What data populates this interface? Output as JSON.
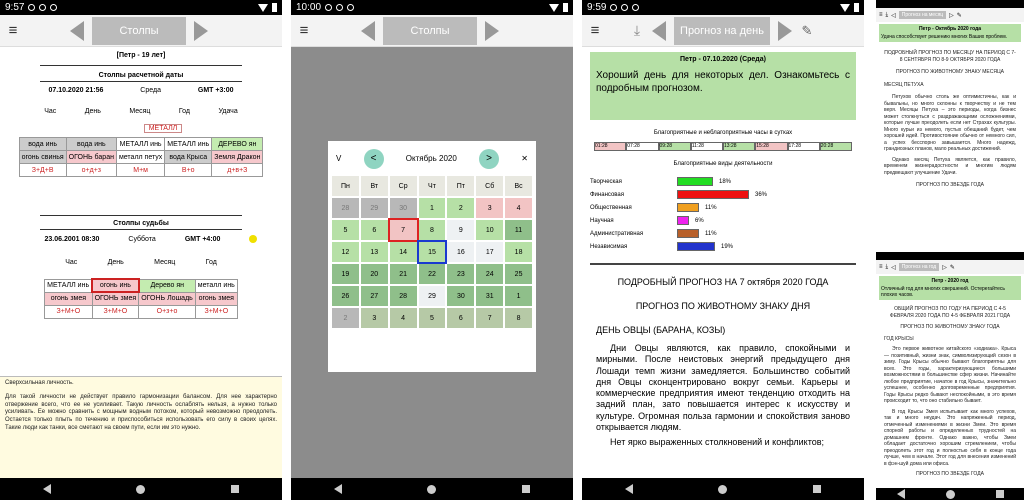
{
  "phone1": {
    "time": "9:57",
    "title": "Столпы",
    "name": "[Петр - 19 лет]",
    "sec1": "Столпы расчетной даты",
    "date1": "07.10.2020 21:56",
    "day1": "Среда",
    "gmt1": "GMT +3:00",
    "cols": [
      "Час",
      "День",
      "Месяц",
      "Год",
      "Удача"
    ],
    "extra": "МЕТАЛЛ",
    "r1": [
      "вода инь",
      "вода инь",
      "МЕТАЛЛ инь",
      "МЕТАЛЛ инь",
      "ДЕРЕВО ян"
    ],
    "r2": [
      "огонь свинья",
      "ОГОНЬ баран",
      "металл петух",
      "вода Крыса",
      "Земля Дракон"
    ],
    "r3": [
      "З+Д+В",
      "о+д+з",
      "М+м",
      "В+о",
      "д+в+З"
    ],
    "sec2": "Столпы судьбы",
    "date2": "23.06.2001 08:30",
    "day2": "Суббота",
    "gmt2": "GMT +4:00",
    "cols2": [
      "Час",
      "День",
      "Месяц",
      "Год"
    ],
    "s1": [
      "МЕТАЛЛ инь",
      "огонь инь",
      "Дерево ян",
      "металл инь"
    ],
    "s2": [
      "огонь змея",
      "ОГОНЬ змея",
      "ОГОНЬ Лошадь",
      "огонь змея"
    ],
    "s3": [
      "З+М+О",
      "З+М+О",
      "О+з+о",
      "З+М+О"
    ],
    "desc": [
      "Сверхсильная личность.",
      "Для такой личности не действует правило гармонизации балансом. Для нее характерно отвержение всего, что ее не усиливает. Такую личность ослаблять нельзя, а нужно только усиливать. Ее можно сравнить с мощным водным потоком, который невозможно преодолеть. Остается только плыть по течению и приспособиться использовать его силу в своих целях. Такие люди как танки, все сметают на своем пути, если им это нужно."
    ]
  },
  "phone2": {
    "time": "10:00",
    "title": "Столпы",
    "month": "Октябрь 2020",
    "wd": [
      "Пн",
      "Вт",
      "Ср",
      "Чт",
      "Пт",
      "Сб",
      "Вс"
    ],
    "days": [
      "28",
      "29",
      "30",
      "1",
      "2",
      "3",
      "4",
      "5",
      "6",
      "7",
      "8",
      "9",
      "10",
      "11",
      "12",
      "13",
      "14",
      "15",
      "16",
      "17",
      "18",
      "19",
      "20",
      "21",
      "22",
      "23",
      "24",
      "25",
      "26",
      "27",
      "28",
      "29",
      "30",
      "31",
      "1",
      "2",
      "3",
      "4",
      "5",
      "6",
      "7",
      "8"
    ],
    "v": "V",
    "close": "✕",
    "prev": "<",
    "next": ">"
  },
  "phone3": {
    "time": "9:59",
    "title": "Прогноз на день",
    "head": "Петр - 07.10.2020 (Среда)",
    "lead": "Хороший день для некоторых дел. Ознакомьтесь с подробным прогнозом.",
    "hours_title": "Благоприятные и неблагоприятные часы в сутках",
    "hours": [
      "01:28",
      "07:28",
      "09:28",
      "11:28",
      "13:28",
      "15:28",
      "17:28",
      "20:28"
    ],
    "act_title": "Благоприятные виды деятельности",
    "acts": [
      {
        "n": "Творческая",
        "p": "18%",
        "v": 18,
        "c": "#22dd22"
      },
      {
        "n": "Финансовая",
        "p": "36%",
        "v": 36,
        "c": "#ee1111"
      },
      {
        "n": "Общественная",
        "p": "11%",
        "v": 11,
        "c": "#f0a020"
      },
      {
        "n": "Научная",
        "p": "6%",
        "v": 6,
        "c": "#ee22ee"
      },
      {
        "n": "Административная",
        "p": "11%",
        "v": 11,
        "c": "#b8602a"
      },
      {
        "n": "Независимая",
        "p": "19%",
        "v": 19,
        "c": "#2233cc"
      }
    ],
    "h1": "ПОДРОБНЫЙ ПРОГНОЗ НА 7 октября 2020 ГОДА",
    "h2": "ПРОГНОЗ ПО ЖИВОТНОМУ ЗНАКУ ДНЯ",
    "h3": "ДЕНЬ ОВЦЫ (БАРАНА, КОЗЫ)",
    "p1": "Дни Овцы являются, как правило, спокойными и мирными. После неистовых энергий предыдущего дня Лошади темп жизни замедляется. Большинство событий дня Овцы сконцентрировано вокруг семьи. Карьеры и коммерческие предприятия имеют тенденцию отходить на задний план, зато повышается интерес к искусству и культуре. Огромная польза гармонии и спокойствия заново открывается людям.",
    "p2": "Нет ярко выраженных столкновений и конфликтов;"
  },
  "phone4": {
    "t1": "Прогноз на месяц",
    "head1": "Петр - Октябрь 2020 года",
    "lead1": "Удача способствует решению многих Ваших проблем.",
    "m1": "ПОДРОБНЫЙ ПРОГНОЗ ПО МЕСЯЦУ НА ПЕРИОД С 7-8 СЕНТЯБРЯ ПО 8-9 ОКТЯБРЯ 2020 ГОДА",
    "m2": "ПРОГНОЗ ПО ЖИВОТНОМУ ЗНАКУ МЕСЯЦА",
    "m3": "МЕСЯЦ ПЕТУХА",
    "mp": "Петухов обычно столь же оптимистичны, как и бывальны, но много склонны к творчеству и не тем веря. Месяцы Петуха – это периоды, когда бизнес может столкнуться с раздражающими осложнениями, которые лучше преодолеть если нет Страхах культуры. Много курьи из немого, пустых обещаний будет, чем хорошей идей. Противостояние обычно от немного сил, а успех бесспорно завышается. Много надежд, грандиозных планов, мало реальных достижений.",
    "mp2": "Однако месяц Петуха является, как правило, временем жизнерадостности и многим людям предвещают улучшение Удачи.",
    "m4": "ПРОГНОЗ ПО ЗВЕЗДЕ ГОДА",
    "t2": "Прогноз на год",
    "head2": "Петр - 2020 год",
    "lead2": "Отличный год для многих свершений. Остерегайтесь плохих часов.",
    "y1": "ОБЩИЙ ПРОГНОЗ ПО ГОДУ НА ПЕРИОД С 4-5 ФЕВРАЛЯ 2020 ГОДА ПО 4-5 ФЕВРАЛЯ 2021 ГОДА",
    "y2": "ПРОГНОЗ ПО ЖИВОТНОМУ ЗНАКУ ГОДА",
    "y3": "ГОД КРЫСЫ",
    "yp": "Это первое животное китайского «зодиака». Крыса — позитивный, жизни знак, символизирующий сезон в зиму. Годы Крысы обычно бывают благоприятны для всех. Это годы, характеризующиеся большими возможностями в большинстве сфер жизни. Начинайте любое предприятие, начатое в год Крысы, значительно успешнее, особенно долговременные предприятия. Годы Крысы редко бывают неспокойными, в это время происходит то, что оно стабильно бывает.",
    "yp2": "В год Крысы Змея испытывает как много успехов, так и много неудач. Это напряженный период, отмеченный изменениями в жизни Змеи. Это время спорной работы и определенных трудностей на домашнем фронте. Однако важно, чтобы Змеи обладает достаточно хорошим стремлением, чтобы преодолеть этот год и полностью себя в конце года лучше, чем в начале. Этот год для внесения изменений в фэн-шуй дома или офиса.",
    "y4": "ПРОГНОЗ ПО ЗВЕЗДЕ ГОДА"
  }
}
